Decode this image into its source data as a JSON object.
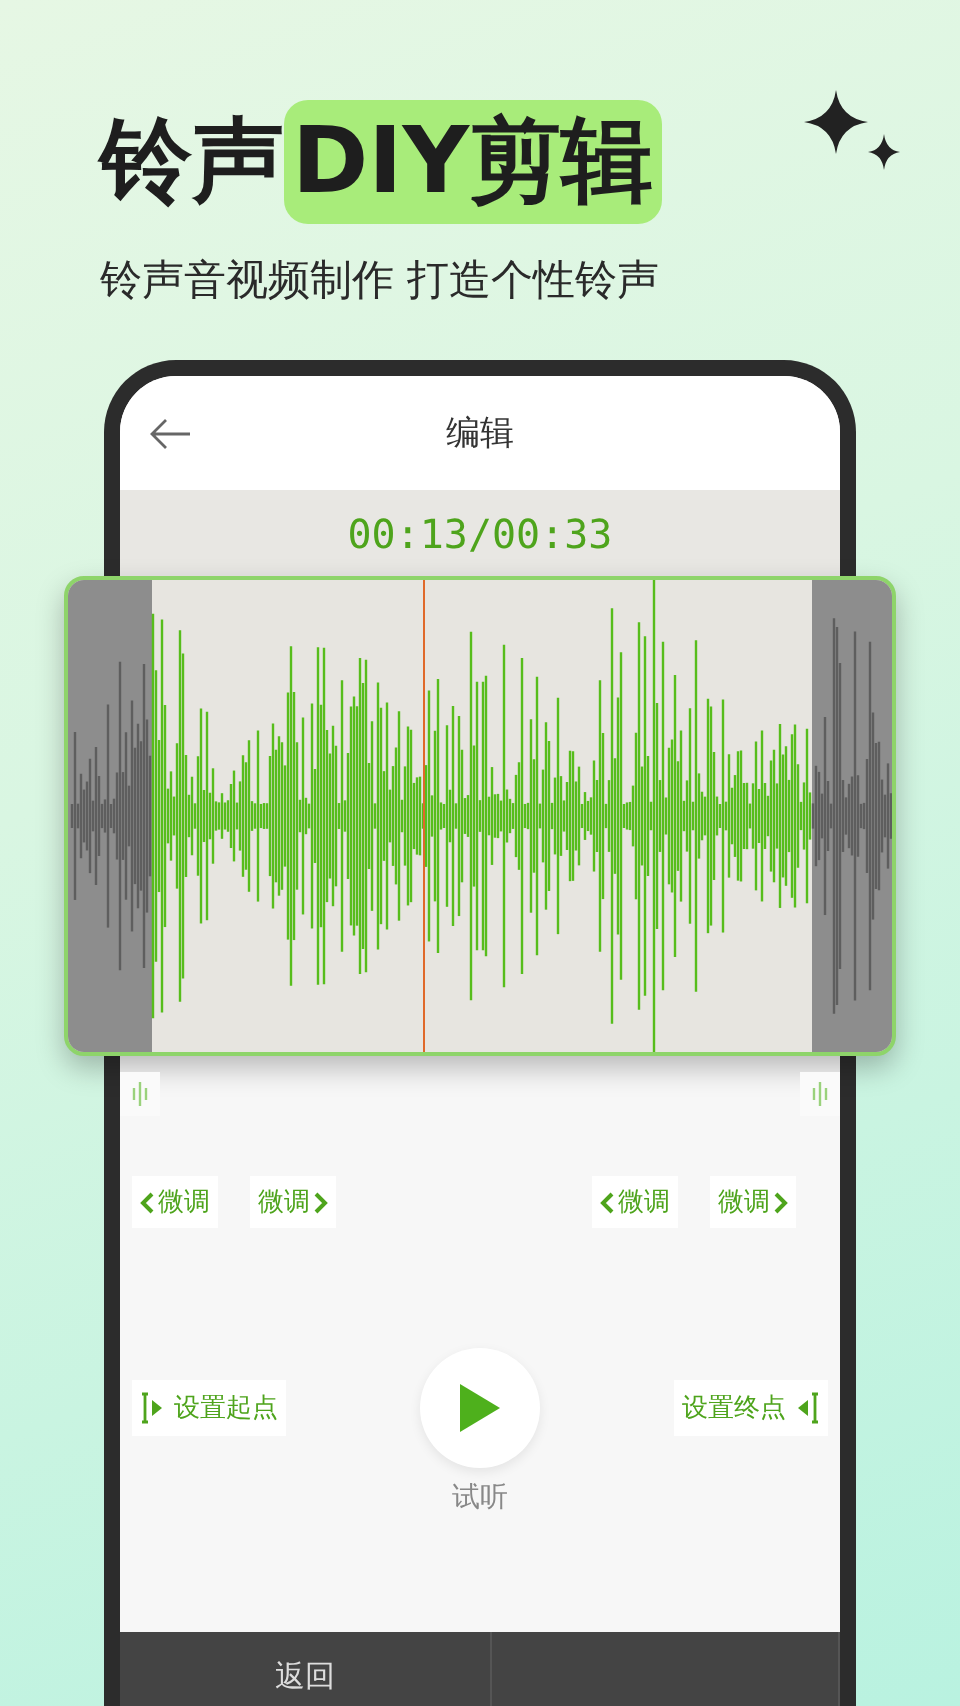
{
  "headline": {
    "text": "铃声",
    "highlight": "DIY剪辑"
  },
  "subtitle": "铃声音视频制作  打造个性铃声",
  "screen": {
    "title": "编辑",
    "time": "00:13/00:33",
    "fine_tune": [
      {
        "label": "微调",
        "kind": "back"
      },
      {
        "label": "微调",
        "kind": "forward"
      },
      {
        "label": "微调",
        "kind": "back"
      },
      {
        "label": "微调",
        "kind": "forward"
      }
    ],
    "set_start": "设置起点",
    "set_end": "设置终点",
    "listen": "试听",
    "bottom_buttons": [
      "返回"
    ]
  }
}
